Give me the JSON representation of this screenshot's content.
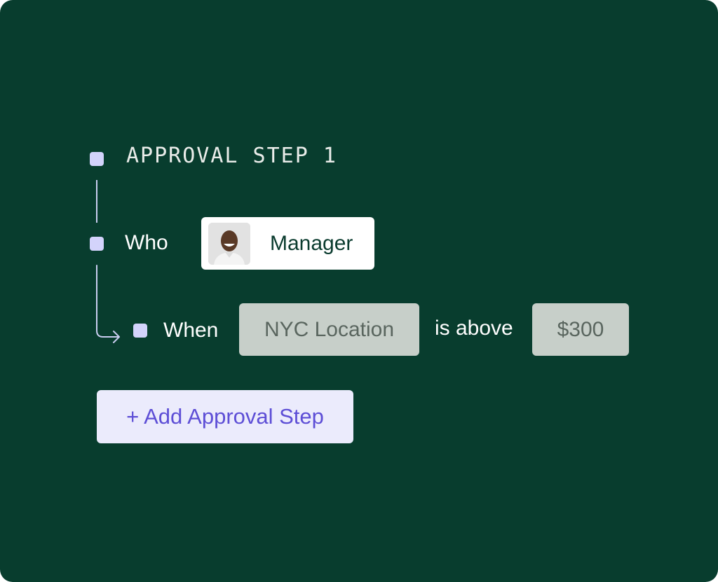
{
  "step_title": "APPROVAL STEP 1",
  "who": {
    "label": "Who",
    "approver": "Manager",
    "avatar_icon": "person-avatar-icon"
  },
  "when": {
    "label": "When",
    "field": "NYC Location",
    "operator": "is above",
    "value": "$300"
  },
  "add_step_label": "+ Add Approval Step",
  "colors": {
    "background": "#083d2e",
    "bullet": "#d3d3fb",
    "condition_chip": "#c7cfc9",
    "add_button_bg": "#ebebfc",
    "add_button_text": "#5d4ed6"
  }
}
